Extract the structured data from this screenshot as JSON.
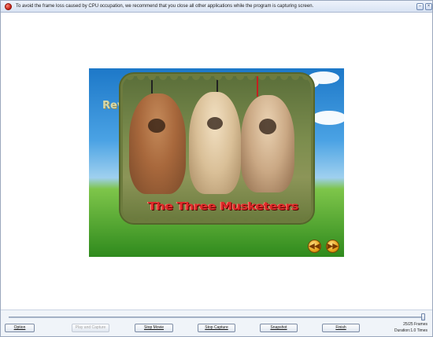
{
  "window": {
    "notice": "To avoid the frame loss caused by CPU occupation, we recommend that you close all other applications while the program is capturing screen.",
    "minimize_glyph": "–",
    "close_glyph": "×"
  },
  "preview": {
    "logo_fragment": "Rev",
    "caption": "The Three Musketeers",
    "prev_glyph": "◀◀",
    "next_glyph": "▶▶"
  },
  "controls": {
    "option": "Option",
    "play_and_capture": "Play and Capture",
    "stop_movie": "Stop Movie",
    "stop_capture": "Stop Capture",
    "snapshot": "Snapshot",
    "finish": "Finish"
  },
  "status": {
    "frames": "25/25 Frames",
    "duration": "Duration:1.0 Times"
  },
  "colors": {
    "accent": "#1d78c8",
    "caption": "#e02a2a",
    "disabled_text": "#a7a7a7"
  },
  "icons": [
    "record-icon",
    "minimize-icon",
    "close-icon",
    "previous-icon",
    "next-icon"
  ]
}
